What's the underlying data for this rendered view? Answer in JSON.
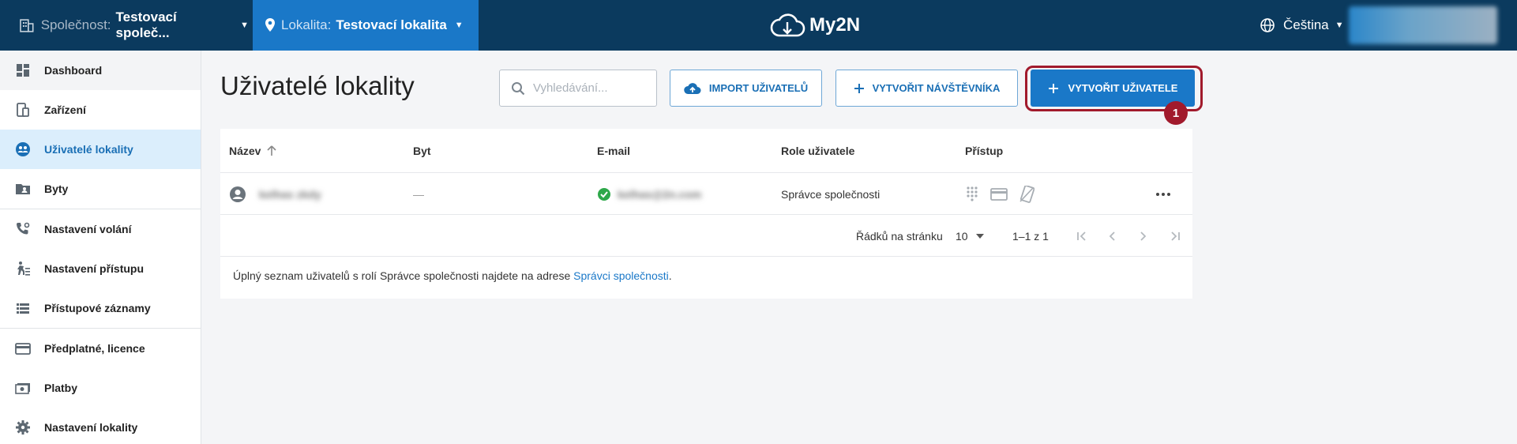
{
  "topbar": {
    "company_label": "Společnost:",
    "company_value": "Testovací společ...",
    "site_label": "Lokalita:",
    "site_value": "Testovací lokalita",
    "logo_text": "My2N",
    "language": "Čeština"
  },
  "sidebar": {
    "items": [
      {
        "label": "Dashboard",
        "icon": "dashboard-icon"
      },
      {
        "label": "Zařízení",
        "icon": "device-icon"
      },
      {
        "label": "Uživatelé lokality",
        "icon": "users-icon"
      },
      {
        "label": "Byty",
        "icon": "apartment-icon"
      },
      {
        "label": "Nastavení volání",
        "icon": "phone-settings-icon"
      },
      {
        "label": "Nastavení přístupu",
        "icon": "access-icon"
      },
      {
        "label": "Přístupové záznamy",
        "icon": "list-icon"
      },
      {
        "label": "Předplatné, licence",
        "icon": "card-icon"
      },
      {
        "label": "Platby",
        "icon": "payment-icon"
      },
      {
        "label": "Nastavení lokality",
        "icon": "gear-icon"
      }
    ]
  },
  "main": {
    "title": "Uživatelé lokality",
    "search_placeholder": "Vyhledávání...",
    "import_label": "IMPORT UŽIVATELŮ",
    "visitor_label": "VYTVOŘIT NÁVŠTĚVNÍKA",
    "create_label": "VYTVOŘIT UŽIVATELE",
    "badge": "1"
  },
  "table": {
    "columns": [
      "Název",
      "Byt",
      "E-mail",
      "Role uživatele",
      "Přístup"
    ],
    "rows": [
      {
        "name": "kelhas zkdy",
        "apartment": "—",
        "email": "kelhas@2n.com",
        "role": "Správce společnosti"
      }
    ],
    "rows_per_page_label": "Řádků na stránku",
    "rows_per_page": "10",
    "range": "1–1 z 1"
  },
  "note": {
    "text": "Úplný seznam uživatelů s rolí Správce společnosti najdete na adrese ",
    "link": "Správci společnosti",
    "end": "."
  },
  "colors": {
    "topbar": "#0b3a5e",
    "accent": "#1a78c8",
    "highlight": "#a11a2c"
  }
}
